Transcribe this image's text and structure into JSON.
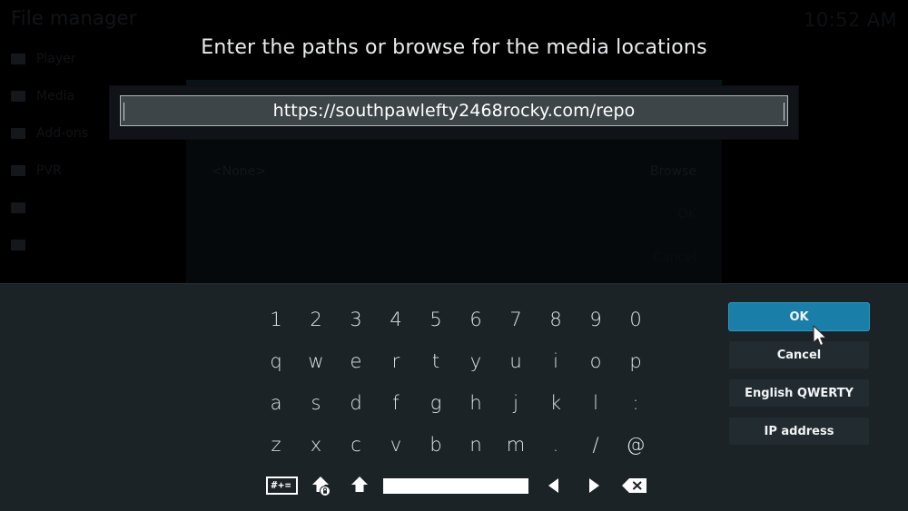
{
  "background": {
    "window_title": "File manager",
    "clock": "10:52 AM",
    "sidebar_items": [
      {
        "label": "Player"
      },
      {
        "label": "Media"
      },
      {
        "label": "Add-ons"
      },
      {
        "label": "PVR"
      },
      {
        "label": ""
      },
      {
        "label": ""
      }
    ],
    "dialog": {
      "path_value": "<None>",
      "browse_label": "Browse",
      "ok_label": "OK",
      "cancel_label": "Cancel"
    }
  },
  "heading": "Enter the paths or browse for the media locations",
  "edit": {
    "value": "https://southpawlefty2468rocky.com/repo"
  },
  "keyboard": {
    "rows": [
      [
        "1",
        "2",
        "3",
        "4",
        "5",
        "6",
        "7",
        "8",
        "9",
        "0"
      ],
      [
        "q",
        "w",
        "e",
        "r",
        "t",
        "y",
        "u",
        "i",
        "o",
        "p"
      ],
      [
        "a",
        "s",
        "d",
        "f",
        "g",
        "h",
        "j",
        "k",
        "l",
        ":"
      ],
      [
        "z",
        "x",
        "c",
        "v",
        "b",
        "n",
        "m",
        ".",
        "/",
        "@"
      ]
    ],
    "symbols_label": "#+=",
    "caps_label": "caps-lock",
    "shift_label": "shift",
    "space_label": "space",
    "left_label": "cursor-left",
    "right_label": "cursor-right",
    "backspace_label": "backspace"
  },
  "actions": [
    {
      "label": "OK",
      "focused": true
    },
    {
      "label": "Cancel",
      "focused": false
    },
    {
      "label": "English QWERTY",
      "focused": false
    },
    {
      "label": "IP address",
      "focused": false
    }
  ],
  "colors": {
    "accent": "#1a7fa8",
    "panel": "#1b2327",
    "button": "#222b2f",
    "text": "#e9ecee",
    "field": "#3e4549"
  }
}
